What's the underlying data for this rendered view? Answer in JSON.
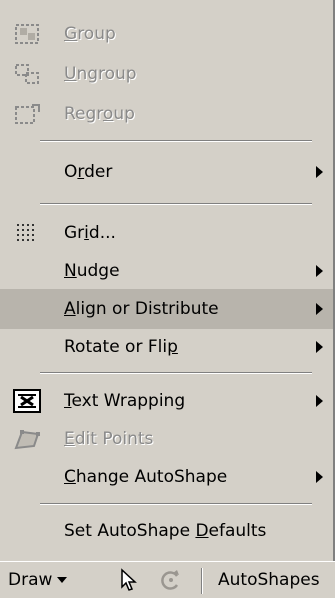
{
  "menu": {
    "items": [
      {
        "label": "Group",
        "u": "G",
        "icon": "group-icon",
        "disabled": true
      },
      {
        "label": "Ungroup",
        "u": "U",
        "icon": "ungroup-icon",
        "disabled": true
      },
      {
        "label": "Regroup",
        "u": "o",
        "icon": "regroup-icon",
        "disabled": true
      },
      {
        "label": "Order",
        "u": "r",
        "submenu": true
      },
      {
        "label": "Grid...",
        "u": "i",
        "icon": "grid-icon"
      },
      {
        "label": "Nudge",
        "u": "N",
        "submenu": true
      },
      {
        "label": "Align or Distribute",
        "u": "A",
        "submenu": true,
        "highlighted": true
      },
      {
        "label": "Rotate or Flip",
        "u": "p",
        "submenu": true
      },
      {
        "label": "Text Wrapping",
        "u": "T",
        "icon": "text-wrapping-icon",
        "submenu": true
      },
      {
        "label": "Edit Points",
        "u": "E",
        "icon": "edit-points-icon",
        "disabled": true
      },
      {
        "label": "Change AutoShape",
        "u": "C",
        "submenu": true
      },
      {
        "label": "Set AutoShape Defaults",
        "u": "D"
      }
    ]
  },
  "toolbar": {
    "draw_label": "Draw",
    "autoshapes_label": "AutoShapes"
  }
}
